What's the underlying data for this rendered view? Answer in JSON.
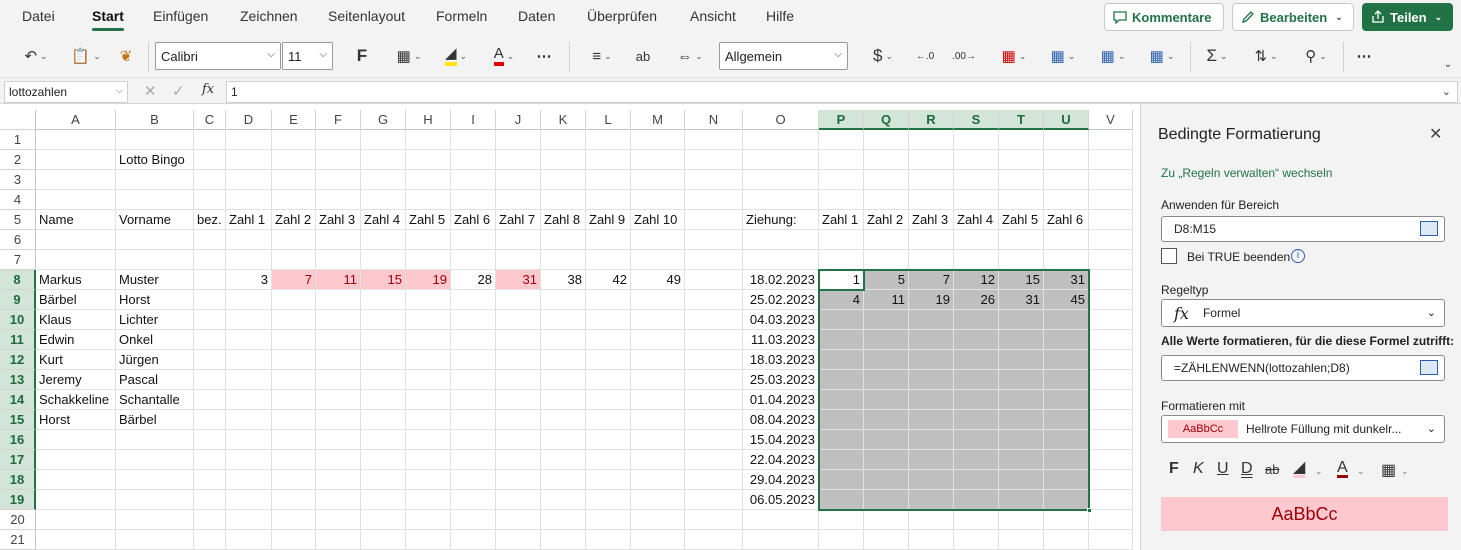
{
  "menu": {
    "items": [
      "Datei",
      "Start",
      "Einfügen",
      "Zeichnen",
      "Seitenlayout",
      "Formeln",
      "Daten",
      "Überprüfen",
      "Ansicht",
      "Hilfe"
    ],
    "kommentare": "Kommentare",
    "bearbeiten": "Bearbeiten",
    "teilen": "Teilen"
  },
  "toolbar": {
    "font": "Calibri",
    "size": "11",
    "bold": "F",
    "numformat": "Allgemein",
    "currency": "$"
  },
  "formulabar": {
    "namebox": "lottozahlen",
    "fx": "fx",
    "formula": "1"
  },
  "sheet": {
    "columns": [
      "A",
      "B",
      "C",
      "D",
      "E",
      "F",
      "G",
      "H",
      "I",
      "J",
      "K",
      "L",
      "M",
      "N",
      "O",
      "P",
      "Q",
      "R",
      "S",
      "T",
      "U",
      "V"
    ],
    "rows": [
      "1",
      "2",
      "3",
      "4",
      "5",
      "6",
      "7",
      "8",
      "9",
      "10",
      "11",
      "12",
      "13",
      "14",
      "15",
      "16",
      "17",
      "18",
      "19",
      "20",
      "21"
    ],
    "title": "Lotto Bingo",
    "header_left": [
      "Name",
      "Vorname",
      "bez.",
      "Zahl 1",
      "Zahl 2",
      "Zahl 3",
      "Zahl 4",
      "Zahl 5",
      "Zahl 6",
      "Zahl 7",
      "Zahl 8",
      "Zahl 9",
      "Zahl 10"
    ],
    "ziehung_label": "Ziehung:",
    "header_right": [
      "Zahl 1",
      "Zahl 2",
      "Zahl 3",
      "Zahl 4",
      "Zahl 5",
      "Zahl 6"
    ],
    "people": [
      {
        "name": "Markus",
        "vorname": "Muster"
      },
      {
        "name": "Bärbel",
        "vorname": "Horst"
      },
      {
        "name": "Klaus",
        "vorname": "Lichter"
      },
      {
        "name": "Edwin",
        "vorname": "Onkel"
      },
      {
        "name": "Kurt",
        "vorname": "Jürgen"
      },
      {
        "name": "Jeremy",
        "vorname": "Pascal"
      },
      {
        "name": "Schakkeline",
        "vorname": "Schantalle"
      },
      {
        "name": "Horst",
        "vorname": "Bärbel"
      }
    ],
    "markus_numbers": [
      "3",
      "7",
      "11",
      "15",
      "19",
      "28",
      "31",
      "38",
      "42",
      "49"
    ],
    "markus_highlight": [
      false,
      true,
      true,
      true,
      true,
      false,
      true,
      false,
      false,
      false
    ],
    "dates": [
      "18.02.2023",
      "25.02.2023",
      "04.03.2023",
      "11.03.2023",
      "18.03.2023",
      "25.03.2023",
      "01.04.2023",
      "08.04.2023",
      "15.04.2023",
      "22.04.2023",
      "29.04.2023",
      "06.05.2023"
    ],
    "draws": [
      [
        "1",
        "5",
        "7",
        "12",
        "15",
        "31"
      ],
      [
        "4",
        "11",
        "19",
        "26",
        "31",
        "45"
      ]
    ]
  },
  "panel": {
    "title": "Bedingte Formatierung",
    "link": "Zu „Regeln verwalten“ wechseln",
    "range_label": "Anwenden für Bereich",
    "range_value": "D8:M15",
    "stop_true": "Bei TRUE beenden",
    "ruletype_label": "Regeltyp",
    "ruletype_value": "Formel",
    "formula_label": "Alle Werte formatieren, für die diese Formel zutrifft:",
    "formula_value": "=ZÄHLENWENN(lottozahlen;D8)",
    "format_label": "Formatieren mit",
    "format_sample": "AaBbCc",
    "format_value": "Hellrote Füllung mit dunkelr...",
    "preview": "AaBbCc",
    "format_icons": [
      "F",
      "K",
      "U",
      "D",
      "ab"
    ]
  },
  "colors": {
    "accent": "#217346",
    "pink_fill": "#ffc7ce",
    "pink_text": "#9c0006",
    "gray_fill": "#bfbfbf"
  }
}
